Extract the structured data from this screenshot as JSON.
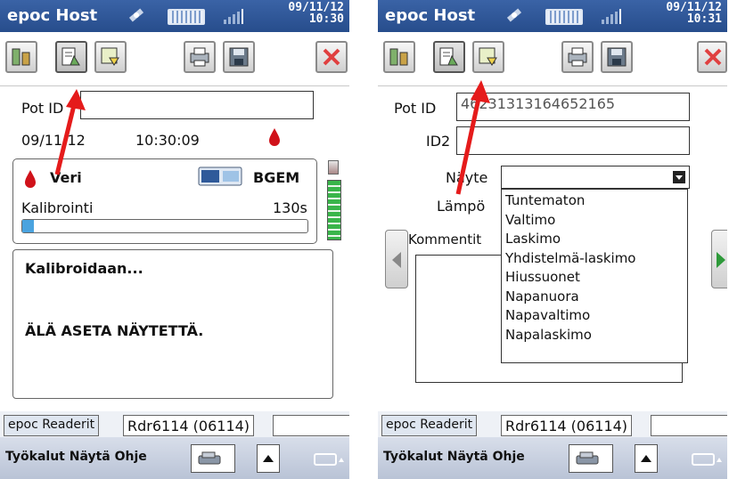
{
  "left": {
    "app_title": "epoc Host",
    "date": "09/11/12",
    "time": "10:30",
    "pot_label": "Pot ID",
    "pot_value": "",
    "reading_date": "09/11/12",
    "reading_time": "10:30:09",
    "sample_type": "Veri",
    "card_type": "BGEM",
    "calibration_label": "Kalibrointi",
    "calibration_time": "130s",
    "calibration_progress": 0.04,
    "message_title": "Kalibroidaan...",
    "message_warning": "ÄLÄ ASETA NÄYTETTÄ.",
    "reader_tab": "epoc Readerit",
    "reader_name": "Rdr6114 (06114)",
    "menu": "Työkalut Näytä Ohje"
  },
  "right": {
    "app_title": "epoc Host",
    "date": "09/11/12",
    "time": "10:31",
    "pot_label": "Pot ID",
    "pot_value": "46231313164652165",
    "id2_label": "ID2",
    "id2_value": "",
    "sample_label": "Näyte",
    "temp_label": "Lämpö",
    "comments_label": "Kommentit",
    "sample_options": [
      "Tuntematon",
      "Valtimo",
      "Laskimo",
      "Yhdistelmä-laskimo",
      "Hiussuonet",
      "Napanuora",
      "Napavaltimo",
      "Napalaskimo"
    ],
    "reader_tab": "epoc Readerit",
    "reader_name": "Rdr6114 (06114)",
    "menu": "Työkalut Näytä Ohje"
  },
  "colors": {
    "titlebar": "#2f5a9a",
    "annotation_arrow": "#e51b1b",
    "blood_drop": "#d0121a",
    "battery_green": "#39b54a",
    "close_red": "#e04040"
  },
  "icons": [
    "satellite-icon",
    "battery-icon",
    "signal-icon",
    "test-tube-icon",
    "clipboard-icon",
    "card-icon",
    "printer-icon",
    "save-icon",
    "close-icon",
    "blood-drop-icon",
    "card-reader-icon",
    "keyboard-icon"
  ]
}
